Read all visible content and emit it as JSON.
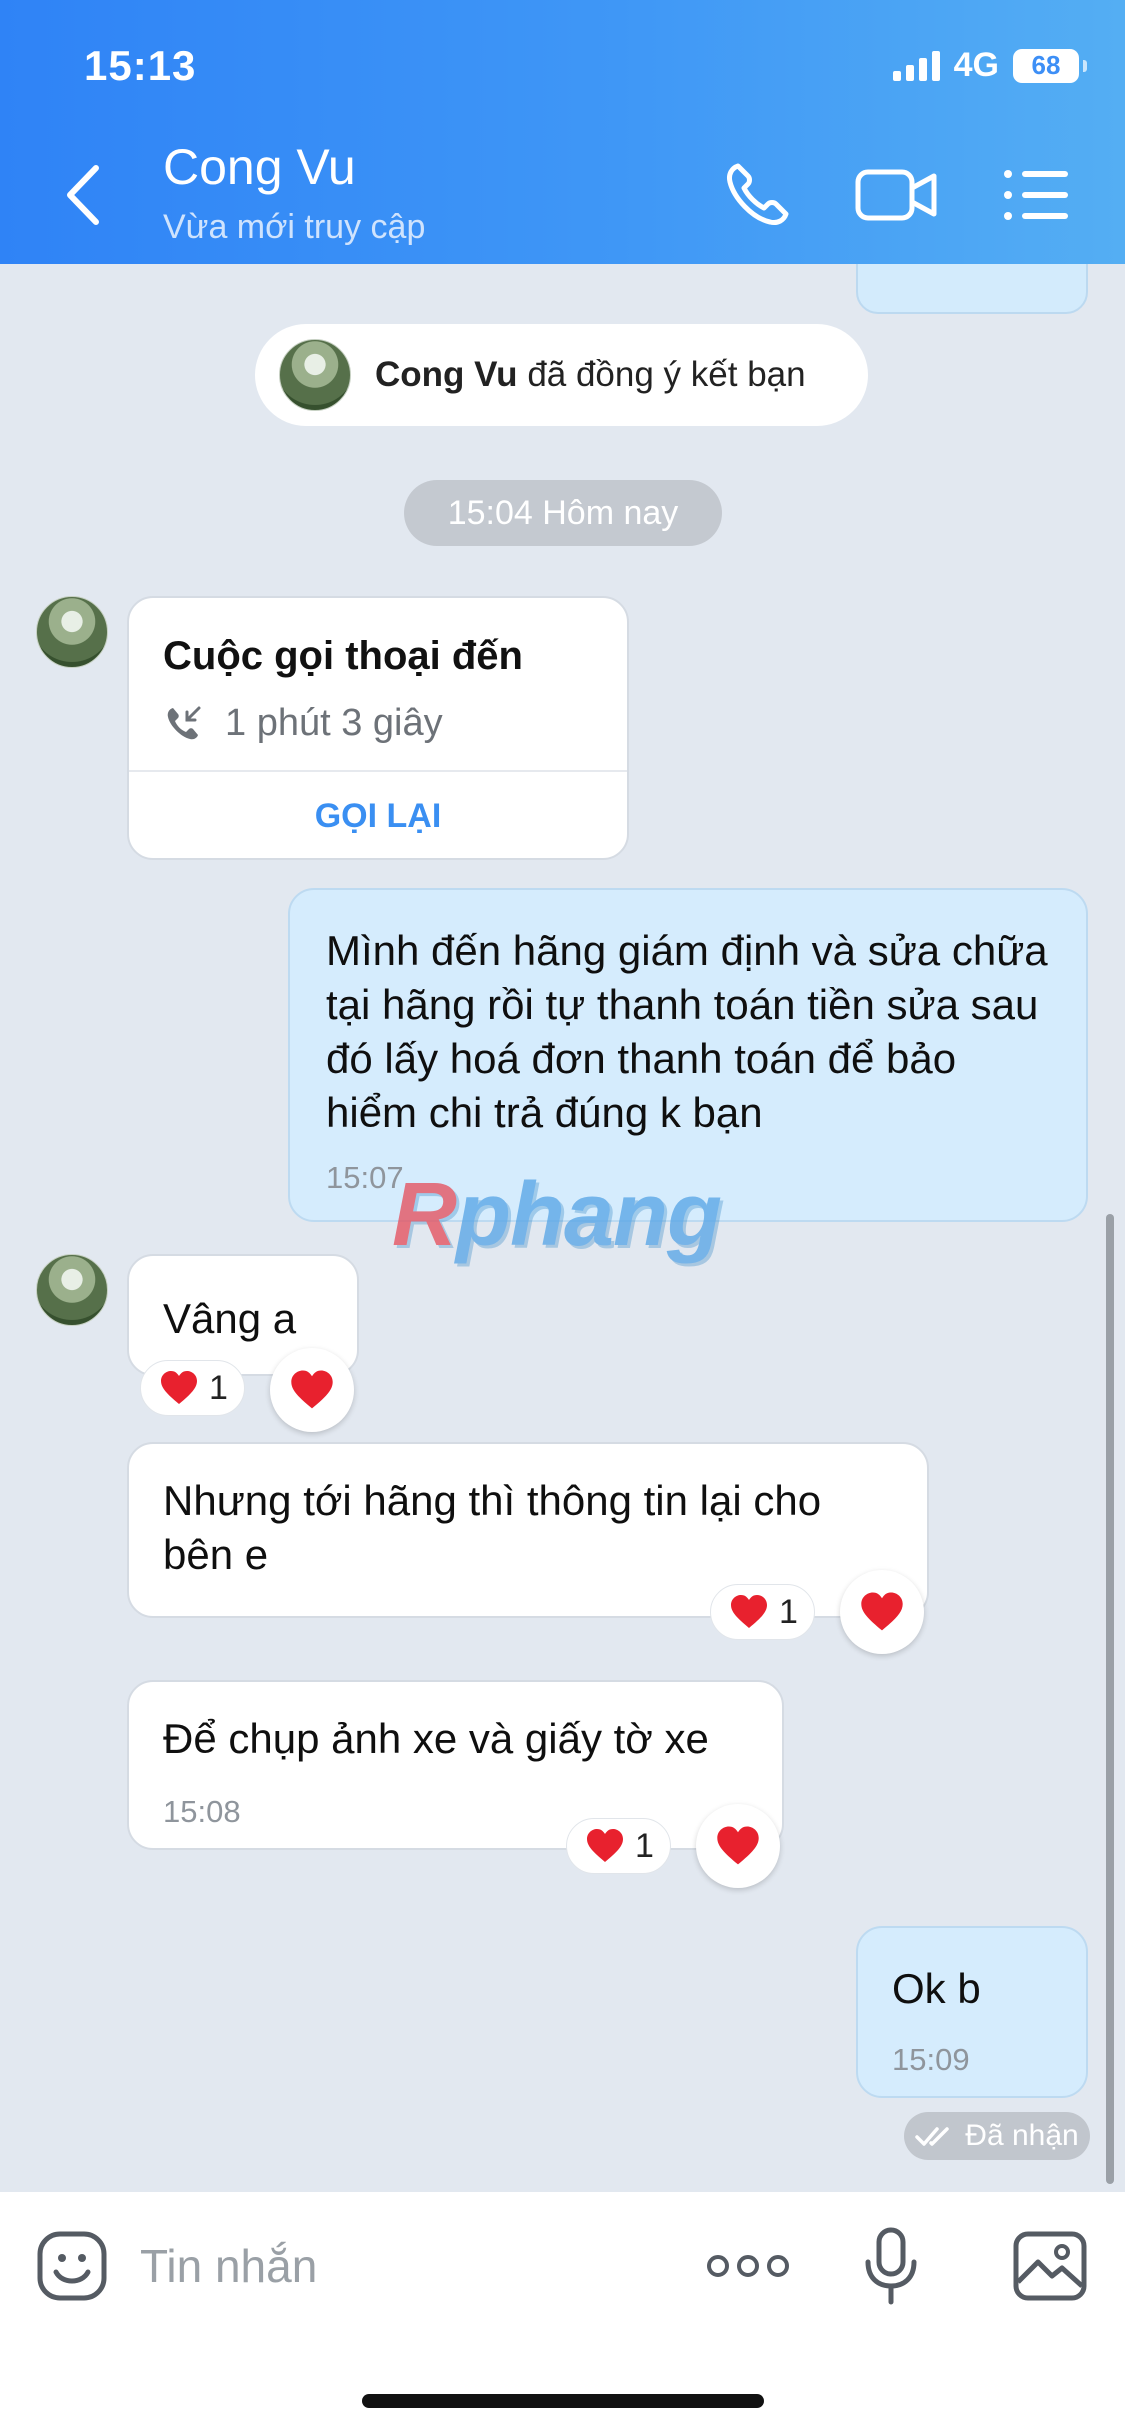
{
  "status_bar": {
    "time": "15:13",
    "network": "4G",
    "battery": "68"
  },
  "header": {
    "contact_name": "Cong Vu",
    "contact_status": "Vừa mới truy cập"
  },
  "system_notice": {
    "name": "Cong Vu",
    "text": "đã đồng ý kết bạn"
  },
  "date_divider": "15:04 Hôm nay",
  "call_card": {
    "title": "Cuộc gọi thoại đến",
    "duration": "1 phút 3 giây",
    "action": "GỌI LẠI"
  },
  "messages": [
    {
      "direction": "out",
      "text": "Mình đến hãng giám định và sửa chữa tại hãng rồi tự thanh toán tiền sửa sau đó lấy hoá đơn thanh toán để bảo hiểm chi trả đúng k bạn",
      "time": "15:07"
    },
    {
      "direction": "in",
      "text": "Vâng a",
      "reaction_count": "1"
    },
    {
      "direction": "in",
      "text": "Nhưng tới hãng thì thông tin lại cho bên e",
      "reaction_count": "1"
    },
    {
      "direction": "in",
      "text": "Để chụp ảnh xe và giấy tờ xe",
      "time": "15:08",
      "reaction_count": "1"
    },
    {
      "direction": "out",
      "text": "Ok b",
      "time": "15:09"
    }
  ],
  "delivery_status": "Đã nhận",
  "watermark": {
    "first": "R",
    "rest": "phang"
  },
  "input": {
    "placeholder": "Tin nhắn"
  },
  "colors": {
    "header_start": "#2f83f6",
    "header_end": "#54aef3",
    "chat_bg": "#e2e8f0",
    "out_bubble": "#d5ecfd",
    "accent": "#3a8ff2",
    "heart": "#e8212e"
  }
}
